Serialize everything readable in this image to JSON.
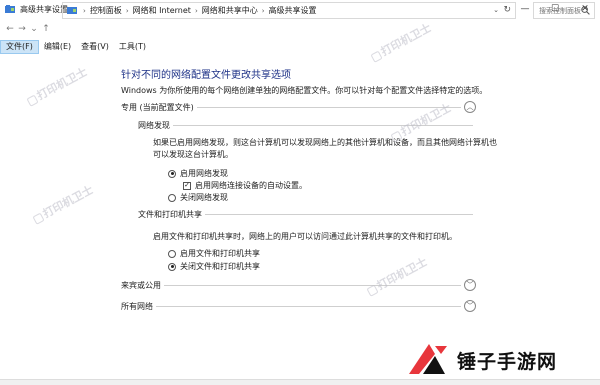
{
  "window": {
    "title": "高级共享设置",
    "minimize_glyph": "—",
    "maximize_glyph": "☐",
    "close_glyph": "✕"
  },
  "nav": {
    "back_glyph": "←",
    "forward_glyph": "→",
    "recent_glyph": "⌄",
    "up_glyph": "↑"
  },
  "address": {
    "breadcrumbs": [
      "控制面板",
      "网络和 Internet",
      "网络和共享中心",
      "高级共享设置"
    ],
    "separator": "›",
    "dropdown_glyph": "⌄",
    "refresh_glyph": "↻"
  },
  "search": {
    "placeholder": "搜索控制面板"
  },
  "menu": {
    "items": [
      "文件(F)",
      "编辑(E)",
      "查看(V)",
      "工具(T)"
    ]
  },
  "page": {
    "heading": "针对不同的网络配置文件更改共享选项",
    "subtext": "Windows 为你所使用的每个网络创建单独的网络配置文件。你可以针对每个配置文件选择特定的选项。"
  },
  "profiles": {
    "private": {
      "label": "专用 (当前配置文件)",
      "network_discovery": {
        "label": "网络发现",
        "desc_line1": "如果已启用网络发现，则这台计算机可以发现网络上的其他计算机和设备，而且其他网络计算机也",
        "desc_line2": "可以发现这台计算机。",
        "option_on": "启用网络发现",
        "option_auto": "启用网络连接设备的自动设置。",
        "option_off": "关闭网络发现",
        "check_glyph": "✓"
      },
      "file_sharing": {
        "label": "文件和打印机共享",
        "desc": "启用文件和打印机共享时，网络上的用户可以访问通过此计算机共享的文件和打印机。",
        "option_on": "启用文件和打印机共享",
        "option_off": "关闭文件和打印机共享"
      }
    },
    "guest": {
      "label": "来宾或公用"
    },
    "all": {
      "label": "所有网络"
    }
  },
  "chevrons": {
    "up": "︿",
    "down": "﹀"
  },
  "watermark": {
    "text": "打印机卫士"
  },
  "logo": {
    "text": "锤子手游网"
  },
  "colors": {
    "heading": "#1e3287",
    "menu_active_bg": "#cce4f7",
    "logo_red": "#e8363c"
  }
}
